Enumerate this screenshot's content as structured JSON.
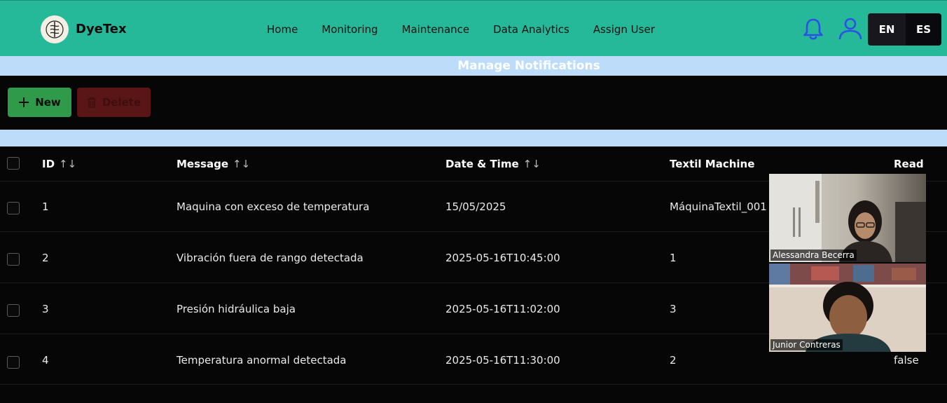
{
  "app": {
    "brand": "DyeTex"
  },
  "nav": {
    "items": [
      "Home",
      "Monitoring",
      "Maintenance",
      "Data Analytics",
      "Assign User"
    ]
  },
  "lang": {
    "en": "EN",
    "es": "ES"
  },
  "page": {
    "title": "Manage Notifications"
  },
  "toolbar": {
    "new_label": "New",
    "delete_label": "Delete"
  },
  "table": {
    "headers": {
      "id": "ID",
      "message": "Message",
      "datetime": "Date & Time",
      "machine": "Textil Machine",
      "read": "Read"
    },
    "sort_glyph": "↑↓",
    "rows": [
      {
        "id": "1",
        "message": "Maquina con exceso de temperatura",
        "datetime": "15/05/2025",
        "machine": "MáquinaTextil_001",
        "read": ""
      },
      {
        "id": "2",
        "message": "Vibración fuera de rango detectada",
        "datetime": "2025-05-16T10:45:00",
        "machine": "1",
        "read": ""
      },
      {
        "id": "3",
        "message": "Presión hidráulica baja",
        "datetime": "2025-05-16T11:02:00",
        "machine": "3",
        "read": ""
      },
      {
        "id": "4",
        "message": "Temperatura anormal detectada",
        "datetime": "2025-05-16T11:30:00",
        "machine": "2",
        "read": "false"
      }
    ]
  },
  "video_call": {
    "participants": [
      {
        "name": "Alessandra Becerra"
      },
      {
        "name": "Junior Contreras"
      }
    ]
  },
  "colors": {
    "header": "#25b899",
    "accent_bar": "#bcdcfa",
    "new_button": "#2f9b4a",
    "delete_button": "#5a1616",
    "icon_blue": "#2b50e8"
  }
}
